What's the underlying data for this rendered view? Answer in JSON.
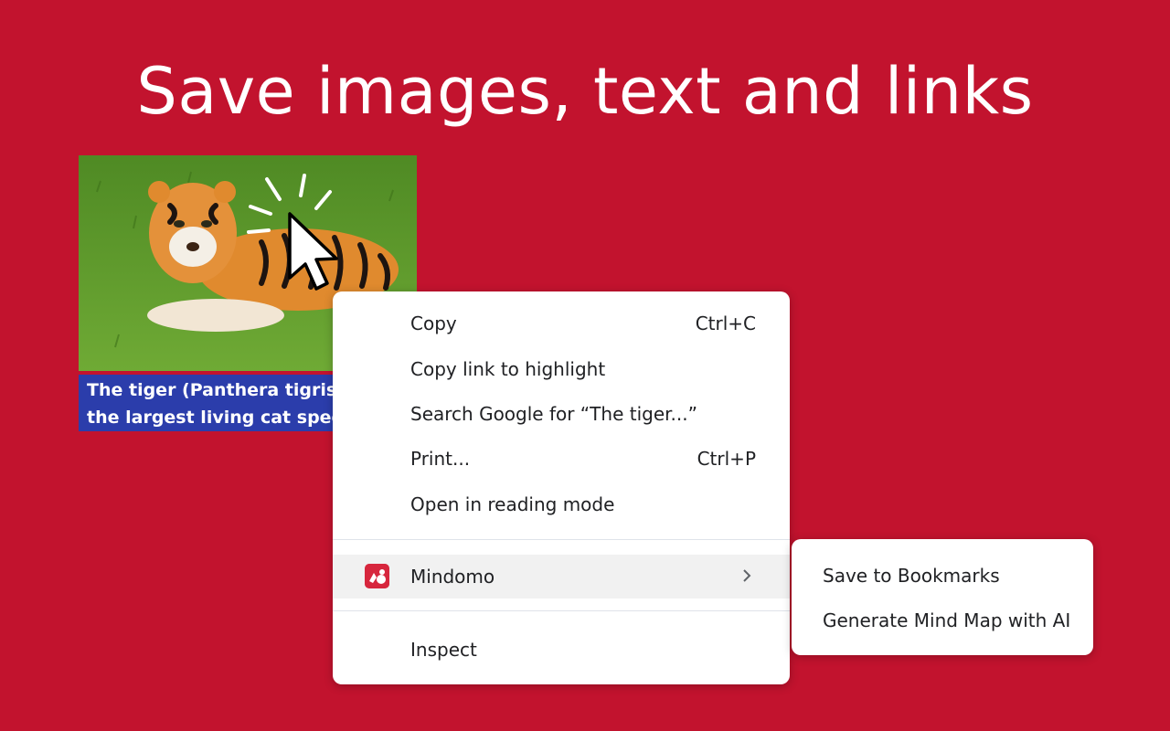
{
  "headline": "Save images, text and links",
  "caption": {
    "line1": "The tiger (Panthera tigris)",
    "line2": "the largest living cat species"
  },
  "context_menu": {
    "items": [
      {
        "label": "Copy",
        "shortcut": "Ctrl+C"
      },
      {
        "label": "Copy link to highlight",
        "shortcut": ""
      },
      {
        "label": "Search Google for “The tiger...”",
        "shortcut": ""
      },
      {
        "label": "Print...",
        "shortcut": "Ctrl+P"
      },
      {
        "label": "Open in reading mode",
        "shortcut": ""
      }
    ],
    "extension": {
      "label": "Mindomo",
      "icon": "mindomo-logo-icon",
      "arrow": "chevron-right-icon"
    },
    "inspect": {
      "label": "Inspect"
    }
  },
  "submenu": {
    "items": [
      {
        "label": "Save to Bookmarks"
      },
      {
        "label": "Generate Mind Map with AI"
      }
    ]
  },
  "colors": {
    "background": "#c2132e",
    "caption_bg": "#2b3dab",
    "menu_bg": "#ffffff",
    "highlight_bg": "#f1f1f1",
    "mindomo_icon": "#d7263d"
  }
}
